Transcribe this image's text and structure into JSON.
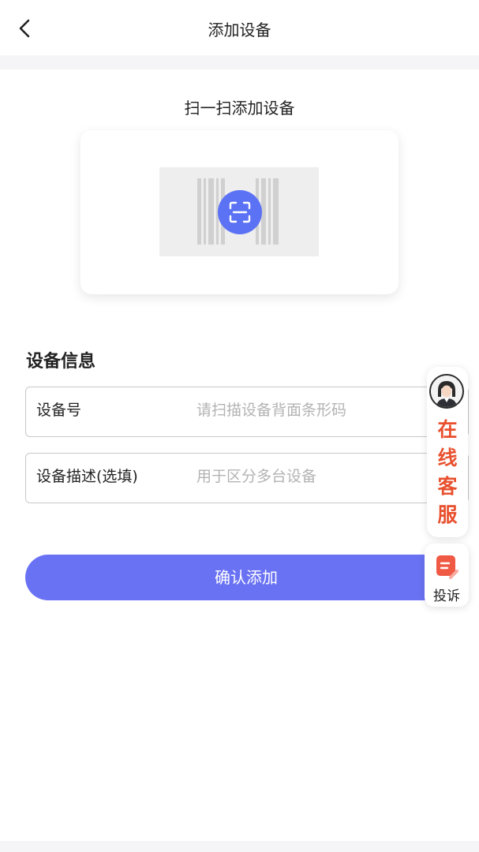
{
  "header": {
    "title": "添加设备",
    "back_icon": "chevron-left-icon"
  },
  "scan": {
    "title": "扫一扫添加设备",
    "accent": "#5b72f5",
    "icon": "scan-icon"
  },
  "device_info": {
    "heading": "设备信息",
    "fields": [
      {
        "label": "设备号",
        "placeholder": "请扫描设备背面条形码",
        "value": ""
      },
      {
        "label": "设备描述(选填)",
        "placeholder": "用于区分多台设备",
        "value": ""
      }
    ]
  },
  "confirm_label": "确认添加",
  "confirm_color": "#6a72f4",
  "support": {
    "chars": [
      "在",
      "线",
      "客",
      "服"
    ],
    "color": "#e8502e",
    "complaint_label": "投诉",
    "complaint_icon": "complaint-note-icon"
  }
}
